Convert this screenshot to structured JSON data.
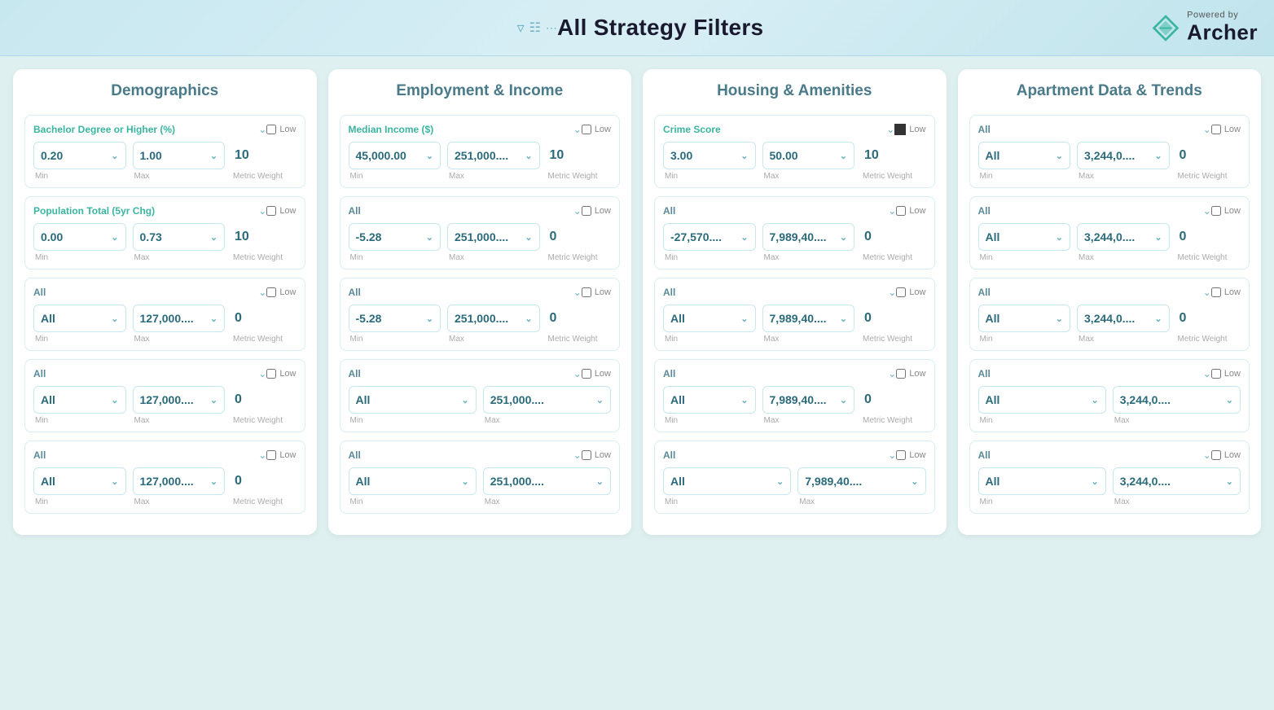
{
  "header": {
    "title": "All Strategy Filters",
    "powered_by": "Powered by",
    "brand": "Archer"
  },
  "columns": [
    {
      "id": "demographics",
      "title": "Demographics",
      "filters": [
        {
          "label": "Bachelor Degree or Higher (%)",
          "has_label": true,
          "low": false,
          "low_filled": false,
          "min": "0.20",
          "max": "1.00",
          "metric_weight": "10"
        },
        {
          "label": "Population Total (5yr Chg)",
          "has_label": true,
          "low": false,
          "low_filled": false,
          "min": "0.00",
          "max": "0.73",
          "metric_weight": "10"
        },
        {
          "label": "All",
          "has_label": false,
          "low": false,
          "low_filled": false,
          "min": "All",
          "max": "127,000....",
          "metric_weight": "0"
        },
        {
          "label": "All",
          "has_label": false,
          "low": false,
          "low_filled": false,
          "min": "All",
          "max": "127,000....",
          "metric_weight": "0"
        },
        {
          "label": "All",
          "has_label": false,
          "low": false,
          "low_filled": false,
          "min": "All",
          "max": "127,000....",
          "metric_weight": "0"
        }
      ]
    },
    {
      "id": "employment",
      "title": "Employment & Income",
      "filters": [
        {
          "label": "Median Income ($)",
          "has_label": true,
          "low": false,
          "low_filled": false,
          "min": "45,000.00",
          "max": "251,000....",
          "metric_weight": "10"
        },
        {
          "label": "All",
          "has_label": false,
          "low": false,
          "low_filled": false,
          "min": "-5.28",
          "max": "251,000....",
          "metric_weight": "0"
        },
        {
          "label": "All",
          "has_label": false,
          "low": false,
          "low_filled": false,
          "min": "-5.28",
          "max": "251,000....",
          "metric_weight": "0"
        },
        {
          "label": "All",
          "has_label": false,
          "low": false,
          "low_filled": false,
          "min": "All",
          "max": "251,000....",
          "metric_weight": ""
        },
        {
          "label": "All",
          "has_label": false,
          "low": false,
          "low_filled": false,
          "min": "All",
          "max": "251,000....",
          "metric_weight": ""
        }
      ]
    },
    {
      "id": "housing",
      "title": "Housing & Amenities",
      "filters": [
        {
          "label": "Crime Score",
          "has_label": true,
          "low": false,
          "low_filled": true,
          "min": "3.00",
          "max": "50.00",
          "metric_weight": "10"
        },
        {
          "label": "All",
          "has_label": false,
          "low": false,
          "low_filled": false,
          "min": "-27,570....",
          "max": "7,989,40....",
          "metric_weight": "0"
        },
        {
          "label": "All",
          "has_label": false,
          "low": false,
          "low_filled": false,
          "min": "All",
          "max": "7,989,40....",
          "metric_weight": "0"
        },
        {
          "label": "All",
          "has_label": false,
          "low": false,
          "low_filled": false,
          "min": "All",
          "max": "7,989,40....",
          "metric_weight": "0"
        },
        {
          "label": "All",
          "has_label": false,
          "low": false,
          "low_filled": false,
          "min": "All",
          "max": "7,989,40....",
          "metric_weight": ""
        }
      ]
    },
    {
      "id": "apartment",
      "title": "Apartment Data & Trends",
      "filters": [
        {
          "label": "All",
          "has_label": false,
          "low": false,
          "low_filled": false,
          "min": "All",
          "max": "3,244,0....",
          "metric_weight": "0"
        },
        {
          "label": "All",
          "has_label": false,
          "low": false,
          "low_filled": false,
          "min": "All",
          "max": "3,244,0....",
          "metric_weight": "0"
        },
        {
          "label": "All",
          "has_label": false,
          "low": false,
          "low_filled": false,
          "min": "All",
          "max": "3,244,0....",
          "metric_weight": "0"
        },
        {
          "label": "All",
          "has_label": false,
          "low": false,
          "low_filled": false,
          "min": "All",
          "max": "3,244,0....",
          "metric_weight": ""
        },
        {
          "label": "All",
          "has_label": false,
          "low": false,
          "low_filled": false,
          "min": "All",
          "max": "3,244,0....",
          "metric_weight": ""
        }
      ]
    }
  ],
  "labels": {
    "min": "Min",
    "max": "Max",
    "metric_weight": "Metric Weight",
    "low": "Low"
  }
}
